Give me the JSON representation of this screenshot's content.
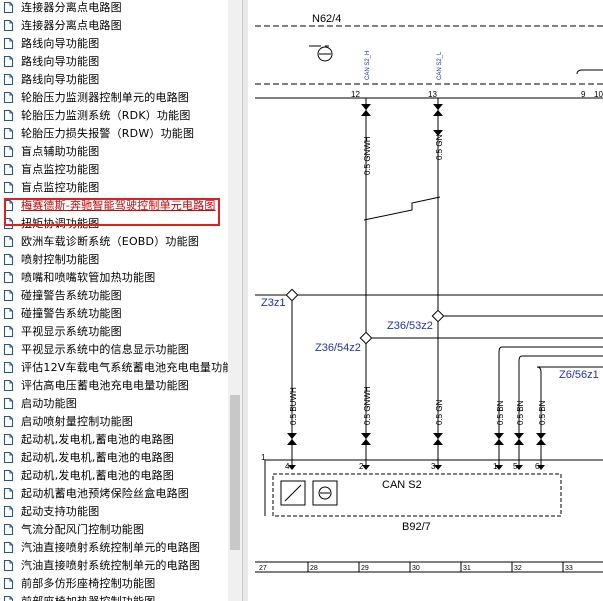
{
  "tree": {
    "items": [
      {
        "label": "连接器分离点电路图"
      },
      {
        "label": "连接器分离点电路图"
      },
      {
        "label": "路线向导功能图"
      },
      {
        "label": "路线向导功能图"
      },
      {
        "label": "路线向导功能图"
      },
      {
        "label": "轮胎压力监测器控制单元的电路图"
      },
      {
        "label": "轮胎压力监测系统（RDK）功能图"
      },
      {
        "label": "轮胎压力损失报警（RDW）功能图"
      },
      {
        "label": "盲点辅助功能图"
      },
      {
        "label": "盲点监控功能图"
      },
      {
        "label": "盲点监控功能图"
      },
      {
        "label": "梅赛德斯-奔驰智能驾驶控制单元电路图",
        "selected": true
      },
      {
        "label": "扭矩协调功能图"
      },
      {
        "label": "欧洲车载诊断系统（EOBD）功能图"
      },
      {
        "label": "喷射控制功能图"
      },
      {
        "label": "喷嘴和喷嘴软管加热功能图"
      },
      {
        "label": "碰撞警告系统功能图"
      },
      {
        "label": "碰撞警告系统功能图"
      },
      {
        "label": "平视显示系统功能图"
      },
      {
        "label": "平视显示系统中的信息显示功能图"
      },
      {
        "label": "评估12V车载电气系统蓄电池充电电量功能"
      },
      {
        "label": "评估高电压蓄电池充电电量功能图"
      },
      {
        "label": "启动功能图"
      },
      {
        "label": "启动喷射量控制功能图"
      },
      {
        "label": "起动机,发电机,蓄电池的电路图"
      },
      {
        "label": "起动机,发电机,蓄电池的电路图"
      },
      {
        "label": "起动机,发电机,蓄电池的电路图"
      },
      {
        "label": "起动机蓄电池预烤保险丝盒电路图"
      },
      {
        "label": "起动支持功能图"
      },
      {
        "label": "气流分配风门控制功能图"
      },
      {
        "label": "汽油直接喷射系统控制单元的电路图"
      },
      {
        "label": "汽油直接喷射系统控制单元的电路图"
      },
      {
        "label": "前部多仿形座椅控制功能图"
      },
      {
        "label": "前部座椅加热器控制功能图"
      }
    ]
  },
  "diagram": {
    "component_top": "N62/4",
    "pin_12": "12",
    "pin_13": "13",
    "pin_9": "9",
    "pin_10": "10",
    "sig_12": "CAN S2_H",
    "sig_13": "CAN S2_L",
    "wire_gnwh": "0.5 GNWH",
    "wire_gn": "0.5 GN",
    "wire_gnwh_low": "0.5 GNWH",
    "wire_gn_low": "0.5 GN",
    "wire_buwh": "0.5 BUWH",
    "wire_bn1": "0.5 BN",
    "wire_bn2": "0.5 BN",
    "wire_bn3": "0.5 BN",
    "node_z3z1": "Z3z1",
    "node_z36_53z2": "Z36/53z2",
    "node_z36_54z2": "Z36/54z2",
    "node_z6_56z1": "Z6/56z1",
    "box_pin_1": "1",
    "pin_4": "4",
    "pin_2": "2",
    "pin_3": "3",
    "pin_1": "1",
    "pin_5": "5",
    "pin_6": "6",
    "box_label": "CAN S2",
    "component_bottom": "B92/7",
    "grid": [
      "27",
      "28",
      "29",
      "30",
      "31",
      "32",
      "33"
    ]
  }
}
